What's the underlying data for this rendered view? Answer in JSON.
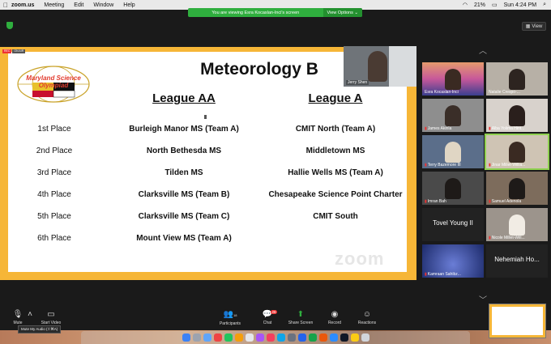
{
  "menubar": {
    "app": "zoom.us",
    "items": [
      "Meeting",
      "Edit",
      "Window",
      "Help"
    ],
    "battery": "21%",
    "clock": "Sun 4:24 PM"
  },
  "share_banner": {
    "text": "You are viewing Esra Kocaslan-Inci's screen",
    "options": "View Options"
  },
  "view_button": "View",
  "slide": {
    "logo_text": "Maryland Science Olympiad",
    "title": "Meteorology B",
    "col_aa": "League AA",
    "col_a": "League A",
    "rows": [
      {
        "place": "1st Place",
        "aa": "Burleigh Manor MS (Team A)",
        "a": "CMIT North (Team A)"
      },
      {
        "place": "2nd Place",
        "aa": "North Bethesda MS",
        "a": "Middletown MS"
      },
      {
        "place": "3rd Place",
        "aa": "Tilden MS",
        "a": "Hallie Wells MS (Team A)"
      },
      {
        "place": "4th Place",
        "aa": "Clarksville MS (Team B)",
        "a": "Chesapeake Science Point Charter"
      },
      {
        "place": "5th Place",
        "aa": "Clarksville MS (Team C)",
        "a": "CMIT South"
      },
      {
        "place": "6th Place",
        "aa": "Mount View MS (Team A)",
        "a": ""
      }
    ],
    "watermark": "zoom"
  },
  "presenter": {
    "name": "Jerry Shen"
  },
  "gallery": [
    {
      "name": "Esra Kocaslan-Inci",
      "muted": false,
      "color": "#c98a7a"
    },
    {
      "name": "Natalie Crespo-...",
      "muted": false,
      "color": "#b7b0a6"
    },
    {
      "name": "James Akinla",
      "muted": true,
      "color": "#8e8e8e"
    },
    {
      "name": "Alba Yolima Hint...",
      "muted": true,
      "color": "#d8d2cc"
    },
    {
      "name": "Terry Bazemore III",
      "muted": true,
      "color": "#5b6e8a"
    },
    {
      "name": "Jinar Millet-Willia...",
      "muted": true,
      "color": "#cfc4b4"
    },
    {
      "name": "Imran Bah",
      "muted": true,
      "color": "#4a4a4a"
    },
    {
      "name": "Samuel Adenola",
      "muted": true,
      "color": "#7d6c5c"
    },
    {
      "name": "Tovel Young II",
      "muted": false,
      "color": "#222222",
      "text_only": true
    },
    {
      "name": "Nicole Millet-Will...",
      "muted": true,
      "color": "#9c948c"
    },
    {
      "name": "Kamraan Sahibz...",
      "muted": true,
      "color": "#2b3d7a"
    },
    {
      "name": "Nehemiah Ho...",
      "muted": false,
      "color": "#222222",
      "text_only": true
    }
  ],
  "toolbar": {
    "mute": "Mute",
    "video": "Start Video",
    "participants": "Participants",
    "participants_count": "18",
    "chat": "Chat",
    "chat_badge": "28",
    "share": "Share Screen",
    "record": "Record",
    "reactions": "Reactions",
    "tooltip": "Mute My Audio (⇧⌘A)"
  }
}
